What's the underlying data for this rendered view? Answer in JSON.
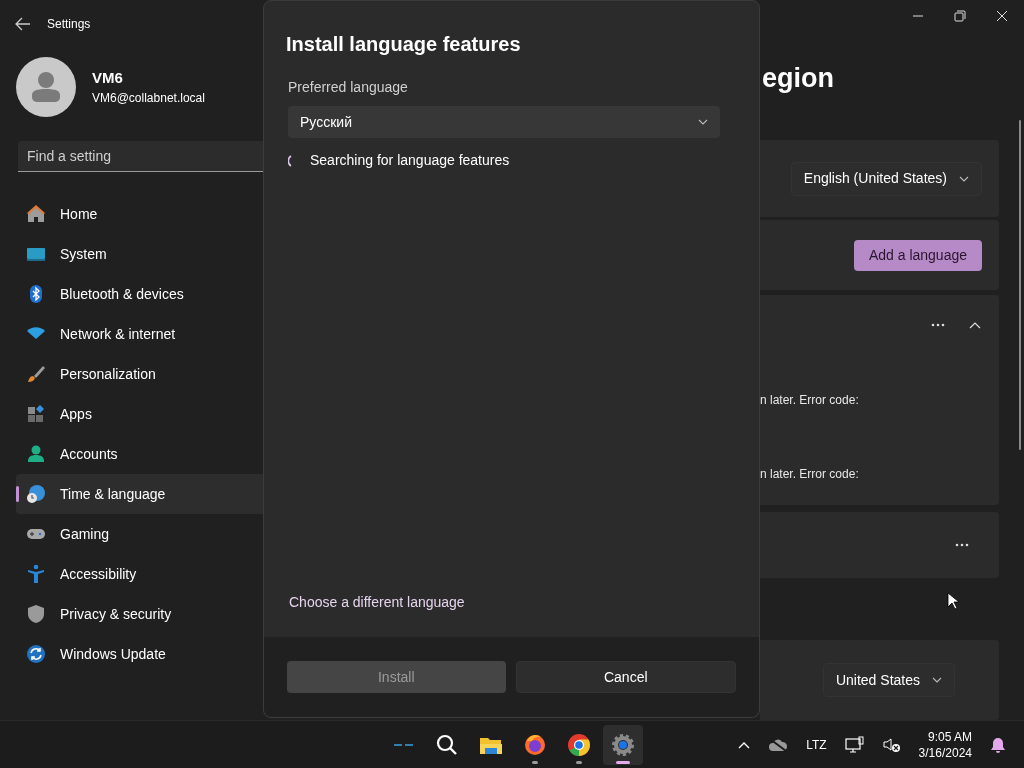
{
  "window": {
    "title": "Settings"
  },
  "user": {
    "name": "VM6",
    "email": "VM6@collabnet.local"
  },
  "search": {
    "placeholder": "Find a setting"
  },
  "sidebar": {
    "items": [
      {
        "label": "Home",
        "selected": false
      },
      {
        "label": "System",
        "selected": false
      },
      {
        "label": "Bluetooth & devices",
        "selected": false
      },
      {
        "label": "Network & internet",
        "selected": false
      },
      {
        "label": "Personalization",
        "selected": false
      },
      {
        "label": "Apps",
        "selected": false
      },
      {
        "label": "Accounts",
        "selected": false
      },
      {
        "label": "Time & language",
        "selected": true
      },
      {
        "label": "Gaming",
        "selected": false
      },
      {
        "label": "Accessibility",
        "selected": false
      },
      {
        "label": "Privacy & security",
        "selected": false
      },
      {
        "label": "Windows Update",
        "selected": false
      }
    ]
  },
  "page": {
    "title": "egion",
    "display_language": "English (United States)",
    "add_button": "Add a language",
    "language_card": {
      "expanded": true,
      "messages": [
        "n later. Error code:",
        "n later. Error code:"
      ]
    },
    "region": "United States"
  },
  "dialog": {
    "title": "Install language features",
    "field_label": "Preferred language",
    "language": "Русский",
    "status": "Searching for language features",
    "link": "Choose a different language",
    "buttons": [
      {
        "label": "Install",
        "disabled": true
      },
      {
        "label": "Cancel",
        "disabled": false
      }
    ]
  },
  "taskbar": {
    "apps": [
      {
        "kind": "widgets",
        "running": false,
        "selected": false
      },
      {
        "kind": "search",
        "running": false,
        "selected": false
      },
      {
        "kind": "explorer",
        "running": false,
        "selected": false
      },
      {
        "kind": "firefox",
        "running": true,
        "selected": false
      },
      {
        "kind": "chrome",
        "running": true,
        "selected": false
      },
      {
        "kind": "settings",
        "running": true,
        "selected": true
      }
    ],
    "tray_label": "LTZ",
    "time": "9:05 AM",
    "date": "3/16/2024"
  }
}
